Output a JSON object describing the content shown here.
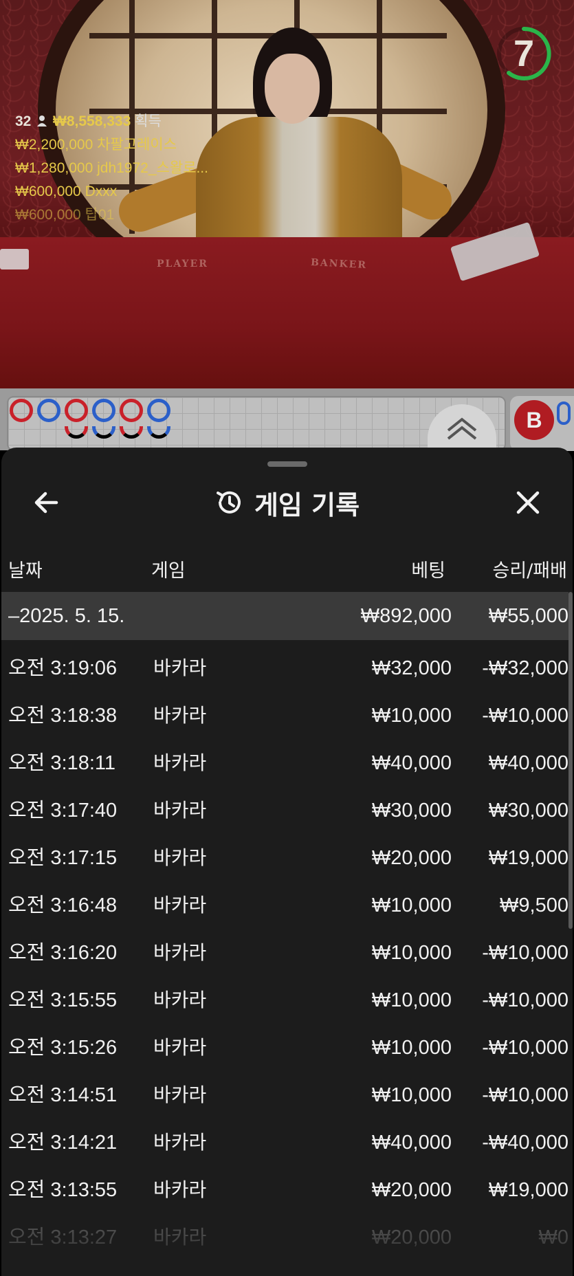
{
  "video": {
    "timer": "7",
    "felt_player": "PLAYER",
    "felt_banker": "BANKER",
    "winners_header": {
      "count": "32",
      "total": "₩8,558,333",
      "label": "획득"
    },
    "winners": [
      {
        "amount": "₩2,200,000",
        "name": "차팔고레이스"
      },
      {
        "amount": "₩1,280,000",
        "name": "jdh1972_스왈로..."
      },
      {
        "amount": "₩600,000",
        "name": "Dxxx"
      },
      {
        "amount": "₩600,000",
        "name": "탑01"
      }
    ]
  },
  "roadmap": {
    "side_badge": "B"
  },
  "sheet": {
    "title": "게임 기록",
    "columns": {
      "date": "날짜",
      "game": "게임",
      "bet": "베팅",
      "win": "승리/패배"
    },
    "date_group": {
      "date": "–2025. 5. 15.",
      "bet_total": "₩892,000",
      "win_total": "₩55,000"
    },
    "rows": [
      {
        "time": "오전 3:19:06",
        "game": "바카라",
        "bet": "₩32,000",
        "win": "-₩32,000"
      },
      {
        "time": "오전 3:18:38",
        "game": "바카라",
        "bet": "₩10,000",
        "win": "-₩10,000"
      },
      {
        "time": "오전 3:18:11",
        "game": "바카라",
        "bet": "₩40,000",
        "win": "₩40,000"
      },
      {
        "time": "오전 3:17:40",
        "game": "바카라",
        "bet": "₩30,000",
        "win": "₩30,000"
      },
      {
        "time": "오전 3:17:15",
        "game": "바카라",
        "bet": "₩20,000",
        "win": "₩19,000"
      },
      {
        "time": "오전 3:16:48",
        "game": "바카라",
        "bet": "₩10,000",
        "win": "₩9,500"
      },
      {
        "time": "오전 3:16:20",
        "game": "바카라",
        "bet": "₩10,000",
        "win": "-₩10,000"
      },
      {
        "time": "오전 3:15:55",
        "game": "바카라",
        "bet": "₩10,000",
        "win": "-₩10,000"
      },
      {
        "time": "오전 3:15:26",
        "game": "바카라",
        "bet": "₩10,000",
        "win": "-₩10,000"
      },
      {
        "time": "오전 3:14:51",
        "game": "바카라",
        "bet": "₩10,000",
        "win": "-₩10,000"
      },
      {
        "time": "오전 3:14:21",
        "game": "바카라",
        "bet": "₩40,000",
        "win": "-₩40,000"
      },
      {
        "time": "오전 3:13:55",
        "game": "바카라",
        "bet": "₩20,000",
        "win": "₩19,000"
      },
      {
        "time": "오전 3:13:27",
        "game": "바카라",
        "bet": "₩20,000",
        "win": "₩0"
      }
    ]
  },
  "colors": {
    "sheet_bg": "#1c1c1c",
    "date_row_bg": "#3a3a3a",
    "winner_gold": "#e6c94a",
    "timer_green": "#2bb54a",
    "road_red": "#c9212a",
    "road_blue": "#2b5fc9"
  }
}
